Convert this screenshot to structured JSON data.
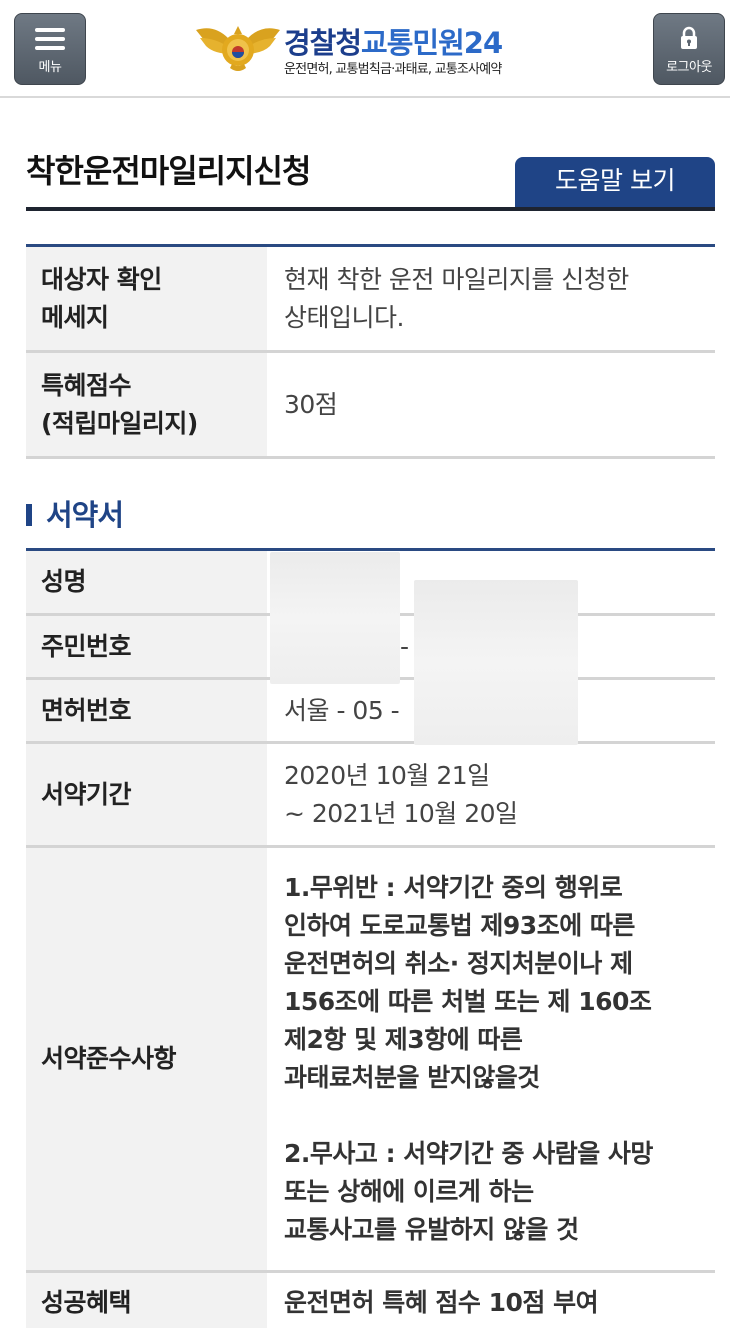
{
  "header": {
    "menu_label": "메뉴",
    "logout_label": "로그아웃",
    "brand_part1": "경찰청",
    "brand_part2": "교통민원24",
    "brand_sub": "운전면허, 교통범칙금·과태료, 교통조사예약"
  },
  "page": {
    "title": "착한운전마일리지신청",
    "help_button": "도움말 보기"
  },
  "status_table": [
    {
      "label": "대상자 확인\n메세지",
      "value": "현재 착한 운전 마일리지를 신청한\n상태입니다."
    },
    {
      "label": "특혜점수\n(적립마일리지)",
      "value": "30점"
    }
  ],
  "pledge_section": {
    "title": "서약서",
    "rows": [
      {
        "label": "성명",
        "value": ""
      },
      {
        "label": "주민번호",
        "value": "-"
      },
      {
        "label": "면허번호",
        "value": "서울 - 05 -"
      },
      {
        "label": "서약기간",
        "value": "2020년 10월 21일\n~ 2021년 10월 20일"
      },
      {
        "label": "서약준수사항",
        "value": "1.무위반 : 서약기간 중의 행위로\n인하여 도로교통법 제93조에 따른\n운전면허의 취소· 정지처분이나 제\n156조에 따른 처벌 또는 제 160조\n제2항 및 제3항에 따른\n과태료처분을 받지않을것\n\n2.무사고 : 서약기간 중 사람을 사망\n또는 상해에 이르게 하는\n교통사고를 유발하지 않을 것"
      },
      {
        "label": "성공혜택",
        "value": "운전면허 특혜 점수 10점 부여"
      }
    ]
  },
  "colors": {
    "navy": "#1f4486",
    "brand_dark": "#1c3e8c",
    "brand_light": "#2c6ac8",
    "header_button": "#5c6570"
  },
  "icons": {
    "menu": "hamburger-icon",
    "logout": "lock-icon",
    "emblem": "police-emblem-icon"
  }
}
